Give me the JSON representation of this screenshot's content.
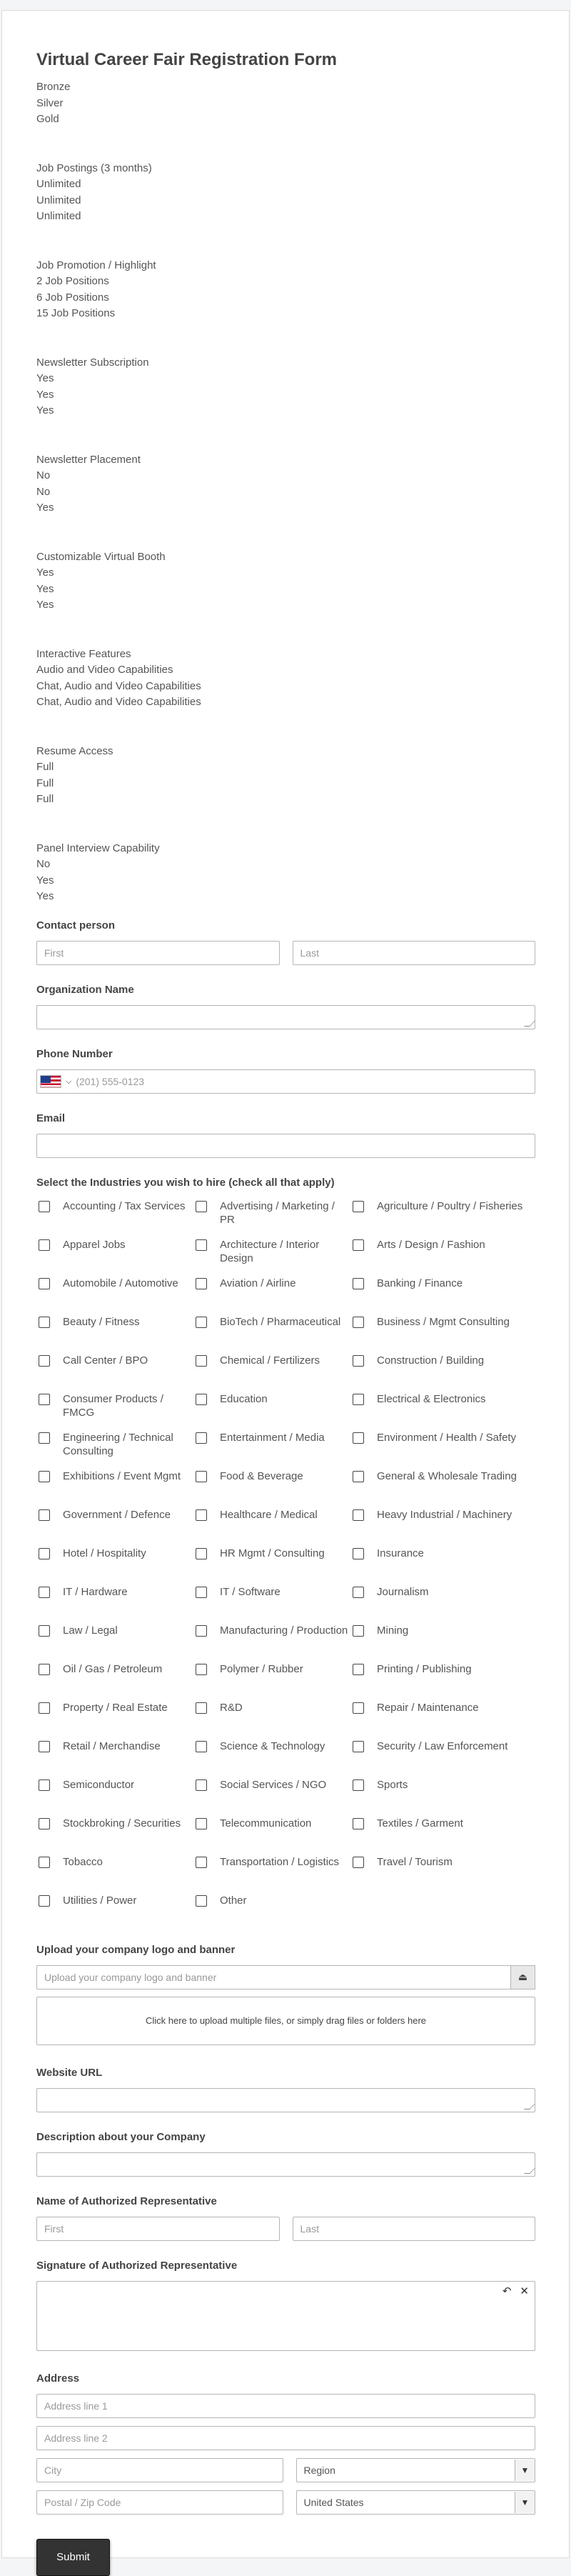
{
  "form": {
    "title": "Virtual Career Fair Registration Form"
  },
  "tiers": [
    {
      "lines": [
        "Bronze",
        "Silver",
        "Gold"
      ]
    },
    {
      "lines": [
        "Job Postings (3 months)",
        "Unlimited",
        "Unlimited",
        "Unlimited"
      ]
    },
    {
      "lines": [
        "Job Promotion / Highlight",
        "2 Job Positions",
        "6 Job Positions",
        "15 Job Positions"
      ]
    },
    {
      "lines": [
        "Newsletter Subscription",
        "Yes",
        "Yes",
        "Yes"
      ]
    },
    {
      "lines": [
        "Newsletter Placement",
        "No",
        "No",
        "Yes"
      ]
    },
    {
      "lines": [
        "Customizable Virtual Booth",
        "Yes",
        "Yes",
        "Yes"
      ]
    },
    {
      "lines": [
        "Interactive Features",
        "Audio and Video Capabilities",
        "Chat, Audio and Video Capabilities",
        "Chat, Audio and Video Capabilities"
      ]
    },
    {
      "lines": [
        "Resume Access",
        "Full",
        "Full",
        "Full"
      ]
    },
    {
      "lines": [
        "Panel Interview Capability",
        "No",
        "Yes",
        "Yes"
      ]
    }
  ],
  "contact": {
    "label": "Contact person",
    "first_placeholder": "First",
    "last_placeholder": "Last"
  },
  "organization": {
    "label": "Organization Name",
    "value": ""
  },
  "phone": {
    "label": "Phone Number",
    "placeholder": "(201) 555-0123",
    "country_flag": "us-flag-icon"
  },
  "email": {
    "label": "Email",
    "value": ""
  },
  "industries": {
    "label": "Select the Industries you wish to hire (check all that apply)",
    "options": [
      "Accounting / Tax Services",
      "Advertising / Marketing / PR",
      "Agriculture / Poultry / Fisheries",
      "Apparel Jobs",
      "Architecture / Interior Design",
      "Arts / Design / Fashion",
      "Automobile / Automotive",
      "Aviation / Airline",
      "Banking / Finance",
      "Beauty / Fitness",
      "BioTech / Pharmaceutical",
      "Business / Mgmt Consulting",
      "Call Center / BPO",
      "Chemical / Fertilizers",
      "Construction / Building",
      "Consumer Products / FMCG",
      "Education",
      "Electrical & Electronics",
      "Engineering / Technical Consulting",
      "Entertainment / Media",
      "Environment / Health / Safety",
      "Exhibitions / Event Mgmt",
      "Food & Beverage",
      "General & Wholesale Trading",
      "Government / Defence",
      "Healthcare / Medical",
      "Heavy Industrial / Machinery",
      "Hotel / Hospitality",
      "HR Mgmt / Consulting",
      "Insurance",
      "IT / Hardware",
      "IT / Software",
      "Journalism",
      "Law / Legal",
      "Manufacturing / Production",
      "Mining",
      "Oil / Gas / Petroleum",
      "Polymer / Rubber",
      "Printing / Publishing",
      "Property / Real Estate",
      "R&D",
      "Repair / Maintenance",
      "Retail / Merchandise",
      "Science & Technology",
      "Security / Law Enforcement",
      "Semiconductor",
      "Social Services / NGO",
      "Sports",
      "Stockbroking / Securities",
      "Telecommunication",
      "Textiles / Garment",
      "Tobacco",
      "Transportation / Logistics",
      "Travel / Tourism",
      "Utilities / Power",
      "Other"
    ]
  },
  "upload": {
    "label": "Upload your company logo and banner",
    "placeholder": "Upload your company logo and banner",
    "dropzone_text": "Click here to upload multiple files, or simply drag files or folders here",
    "icon": "upload-icon"
  },
  "website": {
    "label": "Website URL",
    "value": ""
  },
  "description": {
    "label": "Description about your Company",
    "value": ""
  },
  "representative": {
    "label": "Name of Authorized Representative",
    "first_placeholder": "First",
    "last_placeholder": "Last"
  },
  "signature": {
    "label": "Signature of Authorized Representative",
    "tools": [
      "undo-icon",
      "clear-icon"
    ]
  },
  "address": {
    "label": "Address",
    "line1_placeholder": "Address line 1",
    "line2_placeholder": "Address line 2",
    "city_placeholder": "City",
    "region_value": "Region",
    "postal_placeholder": "Postal / Zip Code",
    "country_value": "United States"
  },
  "submit": {
    "label": "Submit"
  },
  "colors": {
    "submit_bg": "#333333",
    "border": "#b5b5b5",
    "page_bg": "#f4f5f6"
  }
}
